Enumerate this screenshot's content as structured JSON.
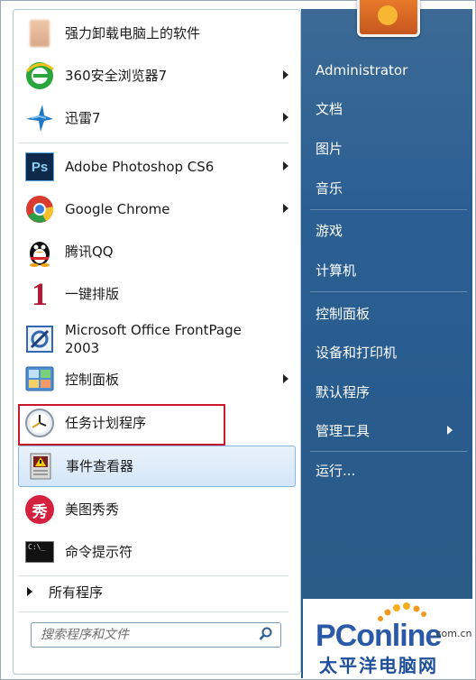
{
  "start_menu": {
    "left_items": [
      {
        "label": "强力卸载电脑上的软件",
        "icon": "blurred-app-icon",
        "has_arrow": false
      },
      {
        "label": "360安全浏览器7",
        "icon": "360-browser-icon",
        "has_arrow": true
      },
      {
        "label": "迅雷7",
        "icon": "thunder-icon",
        "has_arrow": true
      },
      {
        "label": "Adobe Photoshop CS6",
        "icon": "photoshop-icon",
        "has_arrow": true
      },
      {
        "label": "Google Chrome",
        "icon": "chrome-icon",
        "has_arrow": true
      },
      {
        "label": "腾讯QQ",
        "icon": "qq-penguin-icon",
        "has_arrow": false
      },
      {
        "label": "一键排版",
        "icon": "number-one-icon",
        "has_arrow": false
      },
      {
        "label": "Microsoft Office FrontPage",
        "label2": "2003",
        "icon": "frontpage-icon",
        "has_arrow": false
      },
      {
        "label": "控制面板",
        "icon": "control-panel-icon",
        "has_arrow": true
      },
      {
        "label": "任务计划程序",
        "icon": "task-scheduler-clock-icon",
        "has_arrow": false
      },
      {
        "label": "事件查看器",
        "icon": "event-viewer-icon",
        "has_arrow": false
      },
      {
        "label": "美图秀秀",
        "icon": "meitu-icon",
        "has_arrow": false
      },
      {
        "label": "命令提示符",
        "icon": "cmd-icon",
        "has_arrow": false
      }
    ],
    "ps_icon_text": "Ps",
    "one_icon_text": "1",
    "meitu_icon_text": "秀",
    "cmd_icon_text": "C:\\_",
    "all_programs": "所有程序",
    "search_placeholder": "搜索程序和文件",
    "right_items": [
      {
        "label": "Administrator"
      },
      {
        "label": "文档"
      },
      {
        "label": "图片"
      },
      {
        "label": "音乐"
      },
      {
        "label": "游戏"
      },
      {
        "label": "计算机"
      },
      {
        "label": "控制面板"
      },
      {
        "label": "设备和打印机"
      },
      {
        "label": "默认程序"
      },
      {
        "label": "管理工具",
        "has_arrow": true
      },
      {
        "label": "运行..."
      }
    ]
  },
  "watermark": {
    "brand_a": "PC",
    "brand_b": "online",
    "domain": ".com.cn",
    "chinese": "太平洋电脑网"
  },
  "colors": {
    "highlight_box": "#c8182c",
    "right_pane": "#2b5f93",
    "brand_blue": "#2a59a8"
  }
}
